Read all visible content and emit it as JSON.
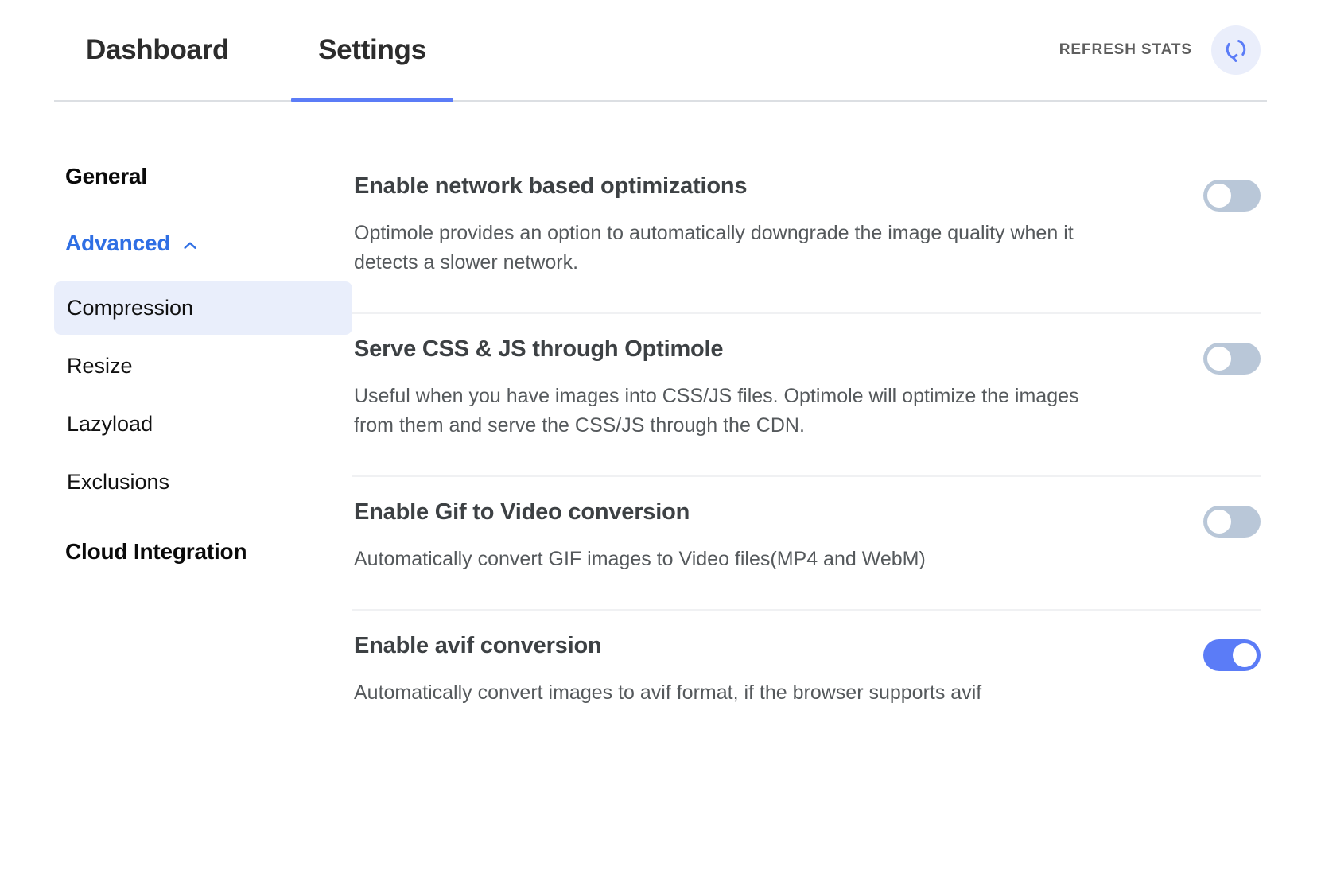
{
  "header": {
    "tabs": [
      {
        "label": "Dashboard",
        "active": false
      },
      {
        "label": "Settings",
        "active": true
      }
    ],
    "refresh_label": "REFRESH STATS",
    "refresh_icon": "refresh-icon"
  },
  "sidebar": {
    "general": {
      "label": "General"
    },
    "advanced": {
      "label": "Advanced",
      "expanded": true,
      "icon": "chevron-up-icon"
    },
    "sub_items": [
      {
        "label": "Compression",
        "selected": true
      },
      {
        "label": "Resize",
        "selected": false
      },
      {
        "label": "Lazyload",
        "selected": false
      },
      {
        "label": "Exclusions",
        "selected": false
      }
    ],
    "cloud_integration": {
      "label": "Cloud Integration"
    }
  },
  "settings": [
    {
      "title": "Enable network based optimizations",
      "description": "Optimole provides an option to automatically downgrade the image quality when it detects a slower network.",
      "toggle_on": false
    },
    {
      "title": "Serve CSS & JS through Optimole",
      "description": "Useful when you have images into CSS/JS files. Optimole will optimize the images from them and serve the CSS/JS through the CDN.",
      "toggle_on": false
    },
    {
      "title": "Enable Gif to Video conversion",
      "description": "Automatically convert GIF images to Video files(MP4 and WebM)",
      "toggle_on": false
    },
    {
      "title": "Enable avif conversion",
      "description": "Automatically convert images to avif format, if the browser supports avif",
      "toggle_on": true
    }
  ],
  "colors": {
    "accent": "#5b7cf7",
    "accent_link": "#2f6fe4",
    "toggle_off": "#b9c7d8",
    "selected_bg": "#e9eefb",
    "divider": "#f0f1f3"
  }
}
